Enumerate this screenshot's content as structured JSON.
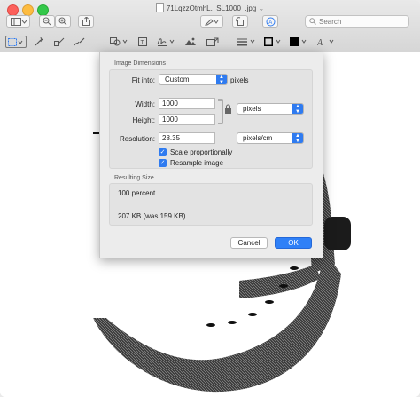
{
  "window": {
    "title": "71LqzzOtmhL._SL1000_.jpg",
    "title_chevron": "⌄"
  },
  "toolbar": {
    "search": {
      "placeholder": "Search"
    }
  },
  "dialog": {
    "dimensions_group_title": "Image Dimensions",
    "fit_into": {
      "label": "Fit into:",
      "value": "Custom",
      "unit": "pixels"
    },
    "width": {
      "label": "Width:",
      "value": "1000"
    },
    "height": {
      "label": "Height:",
      "value": "1000"
    },
    "size_unit": "pixels",
    "resolution": {
      "label": "Resolution:",
      "value": "28.35",
      "unit": "pixels/cm"
    },
    "scale_proportionally": {
      "label": "Scale proportionally",
      "checked": true
    },
    "resample_image": {
      "label": "Resample image",
      "checked": true
    },
    "result_group_title": "Resulting Size",
    "result_percent": "100 percent",
    "result_size": "207 KB (was 159 KB)",
    "cancel_label": "Cancel",
    "ok_label": "OK"
  },
  "colors": {
    "accent": "#2f7bf0",
    "border_color_swatch": "#000000",
    "fill_color_swatch": "#000000"
  }
}
